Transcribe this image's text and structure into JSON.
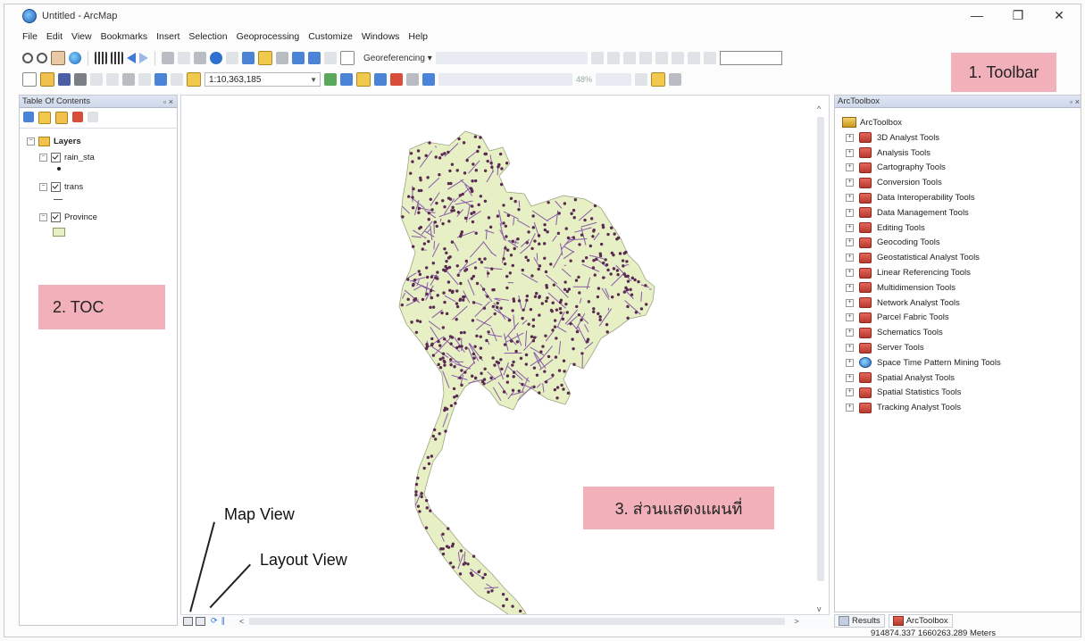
{
  "window": {
    "title": "Untitled - ArcMap",
    "minimize": "—",
    "restore": "❐",
    "close": "✕"
  },
  "menu": [
    "File",
    "Edit",
    "View",
    "Bookmarks",
    "Insert",
    "Selection",
    "Geoprocessing",
    "Customize",
    "Windows",
    "Help"
  ],
  "toolbar": {
    "georeferencing_label": "Georeferencing ▾",
    "scale_value": "1:10,363,185",
    "zoom_percent": "48%"
  },
  "callouts": {
    "toolbar": "1. Toolbar",
    "toc": "2. TOC",
    "map": "3. ส่วนแสดงแผนที่"
  },
  "toc": {
    "title": "Table Of Contents",
    "pin": "▫ ×",
    "root": "Layers",
    "layers": [
      {
        "name": "rain_sta",
        "checked": true,
        "symbol": "point"
      },
      {
        "name": "trans",
        "checked": true,
        "symbol": "line"
      },
      {
        "name": "Province",
        "checked": true,
        "symbol": "polygon"
      }
    ],
    "colors": {
      "province_fill": "#e6f0c4",
      "point": "#5a2a52",
      "line": "#8a5aa8"
    }
  },
  "map_annotations": {
    "map_view": "Map View",
    "layout_view": "Layout View"
  },
  "toolbox": {
    "title": "ArcToolbox",
    "pin": "▫ ×",
    "root": "ArcToolbox",
    "tools": [
      "3D Analyst Tools",
      "Analysis Tools",
      "Cartography Tools",
      "Conversion Tools",
      "Data Interoperability Tools",
      "Data Management Tools",
      "Editing Tools",
      "Geocoding Tools",
      "Geostatistical Analyst Tools",
      "Linear Referencing Tools",
      "Multidimension Tools",
      "Network Analyst Tools",
      "Parcel Fabric Tools",
      "Schematics Tools",
      "Server Tools",
      "Space Time Pattern Mining Tools",
      "Spatial Analyst Tools",
      "Spatial Statistics Tools",
      "Tracking Analyst Tools"
    ],
    "tabs": [
      "Results",
      "ArcToolbox"
    ]
  },
  "status": {
    "coordinates": "914874.337  1660263.289 Meters"
  }
}
